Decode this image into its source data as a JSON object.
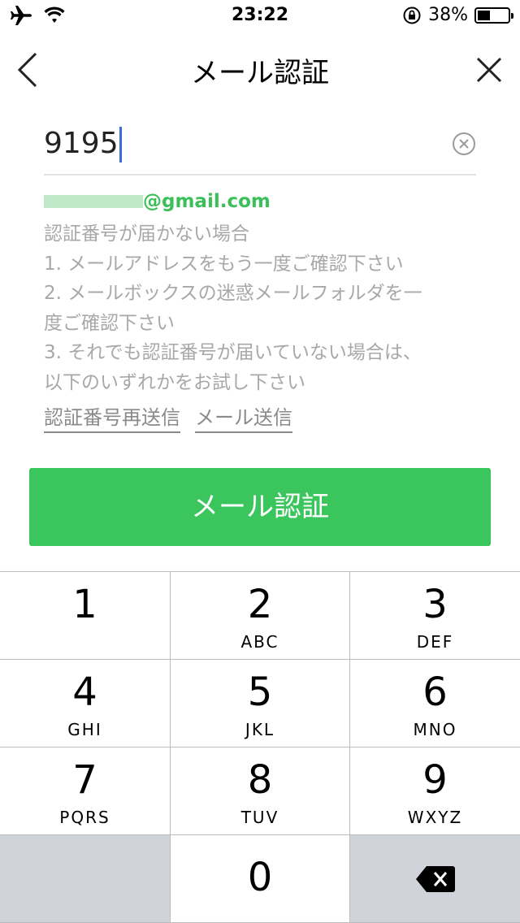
{
  "status_bar": {
    "time": "23:22",
    "battery": "38%",
    "battery_level": 0.38
  },
  "nav": {
    "title": "メール認証"
  },
  "code_input": {
    "value": "9195"
  },
  "email": {
    "domain": "@gmail.com"
  },
  "help": {
    "heading": "認証番号が届かない場合",
    "steps": [
      "1. メールアドレスをもう一度ご確認下さい",
      "2. メールボックスの迷惑メールフォルダを一",
      "度ご確認下さい",
      "3. それでも認証番号が届いていない場合は、",
      "以下のいずれかをお試し下さい"
    ]
  },
  "links": {
    "resend": "認証番号再送信",
    "send_mail": "メール送信"
  },
  "primary_button": {
    "label": "メール認証"
  },
  "keypad": {
    "rows": [
      [
        {
          "digit": "1",
          "letters": ""
        },
        {
          "digit": "2",
          "letters": "ABC"
        },
        {
          "digit": "3",
          "letters": "DEF"
        }
      ],
      [
        {
          "digit": "4",
          "letters": "GHI"
        },
        {
          "digit": "5",
          "letters": "JKL"
        },
        {
          "digit": "6",
          "letters": "MNO"
        }
      ],
      [
        {
          "digit": "7",
          "letters": "PQRS"
        },
        {
          "digit": "8",
          "letters": "TUV"
        },
        {
          "digit": "9",
          "letters": "WXYZ"
        }
      ],
      [
        {
          "digit": "",
          "letters": ""
        },
        {
          "digit": "0",
          "letters": ""
        },
        {
          "digit": "",
          "letters": ""
        }
      ]
    ]
  },
  "colors": {
    "accent_green": "#3ac65c",
    "email_green": "#3bbf59",
    "caret_blue": "#3b6dd8"
  }
}
